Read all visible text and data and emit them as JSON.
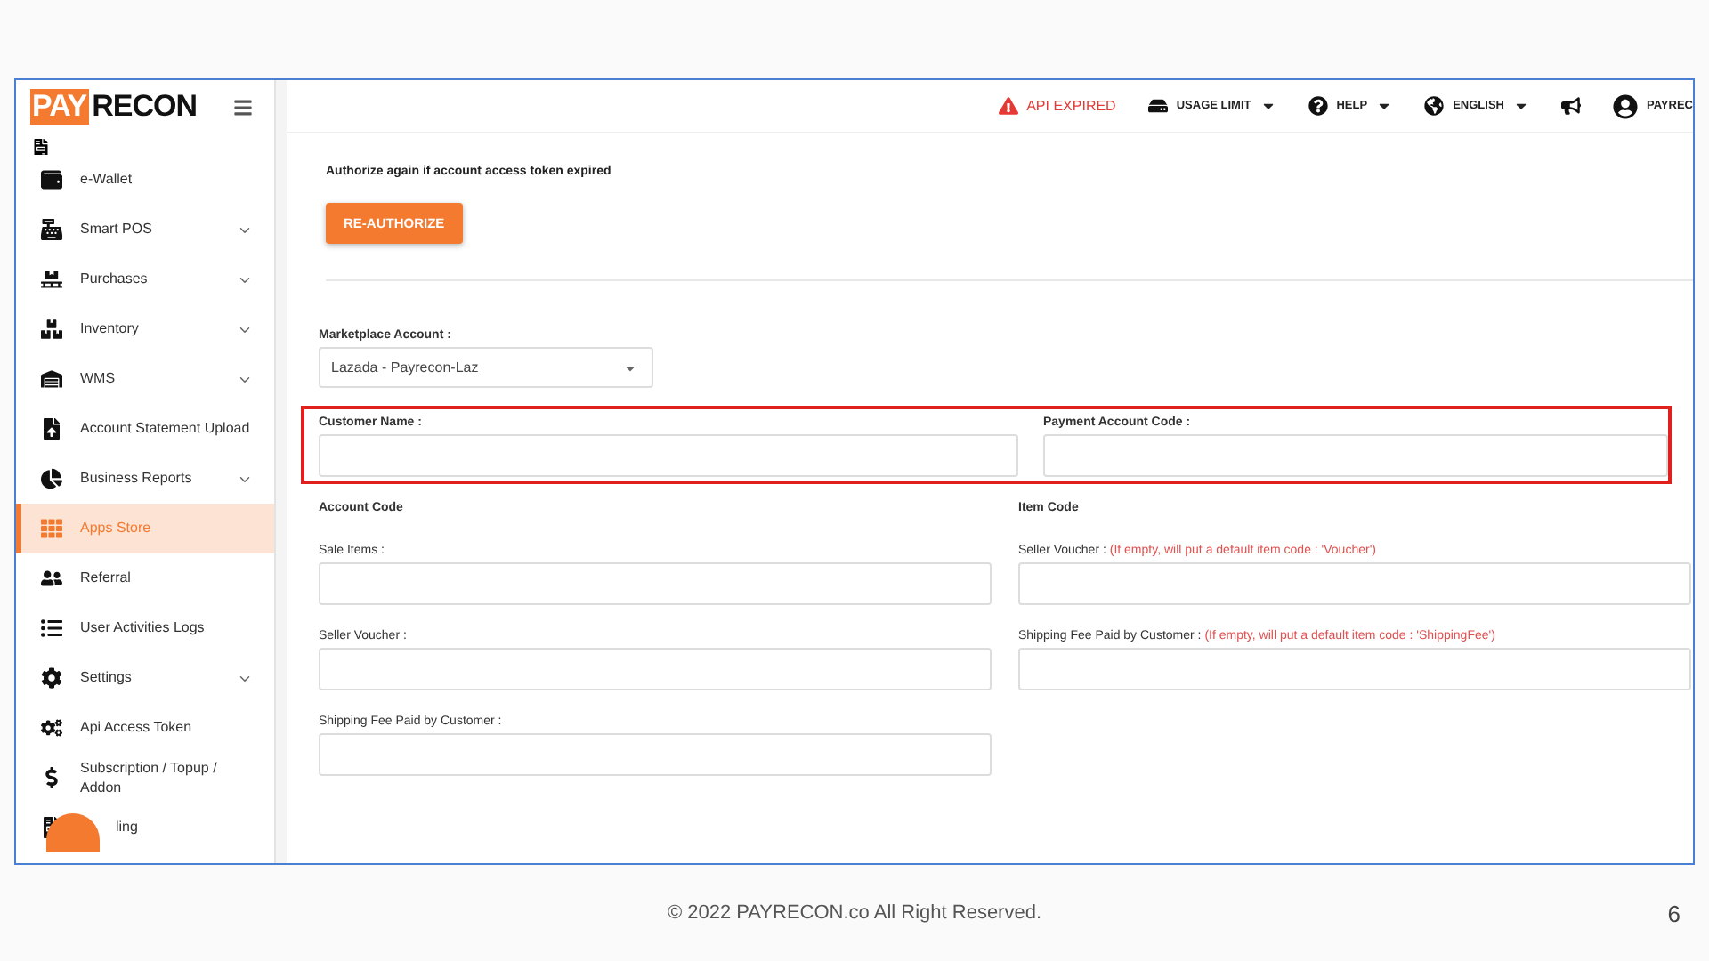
{
  "logo": {
    "part_1": "PAY",
    "part_2": "RECON"
  },
  "sidebar": {
    "items": [
      {
        "label": "e-Wallet",
        "expandable": false,
        "selected": false
      },
      {
        "label": "Smart POS",
        "expandable": true,
        "selected": false
      },
      {
        "label": "Purchases",
        "expandable": true,
        "selected": false
      },
      {
        "label": "Inventory",
        "expandable": true,
        "selected": false
      },
      {
        "label": "WMS",
        "expandable": true,
        "selected": false
      },
      {
        "label": "Account Statement Upload",
        "expandable": false,
        "selected": false
      },
      {
        "label": "Business Reports",
        "expandable": true,
        "selected": false
      },
      {
        "label": "Apps Store",
        "expandable": false,
        "selected": true
      },
      {
        "label": "Referral",
        "expandable": false,
        "selected": false
      },
      {
        "label": "User Activities Logs",
        "expandable": false,
        "selected": false
      },
      {
        "label": "Settings",
        "expandable": true,
        "selected": false
      },
      {
        "label": "Api Access Token",
        "expandable": false,
        "selected": false
      },
      {
        "label": "Subscription / Topup / Addon",
        "expandable": false,
        "selected": false
      },
      {
        "label": "ling",
        "expandable": false,
        "selected": false
      }
    ]
  },
  "topbar": {
    "items": [
      {
        "kind": "alert",
        "label": "API EXPIRED"
      },
      {
        "kind": "dropdown",
        "label": "USAGE LIMIT"
      },
      {
        "kind": "dropdown",
        "label": "HELP"
      },
      {
        "kind": "dropdown",
        "label": "ENGLISH"
      },
      {
        "kind": "icon"
      },
      {
        "kind": "user",
        "label": "PAYREC"
      }
    ]
  },
  "reauth": {
    "note": "Authorize again if account access token expired",
    "button": "RE-AUTHORIZE"
  },
  "marketplace": {
    "label": "Marketplace Account :",
    "value": "Lazada - Payrecon-Laz"
  },
  "highlighted_row": {
    "highlighted": true,
    "fields": [
      {
        "label": "Customer Name :"
      },
      {
        "label": "Payment Account Code :"
      }
    ]
  },
  "account_code": {
    "title": "Account Code",
    "fields": [
      {
        "label": "Sale Items :"
      },
      {
        "label": "Seller Voucher :"
      },
      {
        "label": "Shipping Fee Paid by Customer :"
      }
    ]
  },
  "item_code": {
    "title": "Item Code",
    "fields": [
      {
        "label": "Seller Voucher :",
        "hint": "(If empty, will put a default item code : 'Voucher')"
      },
      {
        "label": "Shipping Fee Paid by Customer :",
        "hint": "(If empty, will put a default item code : 'ShippingFee')"
      }
    ]
  },
  "footer": {
    "copyright": "© 2022 PAYRECON.co All Right Reserved.",
    "page_number": "6"
  }
}
